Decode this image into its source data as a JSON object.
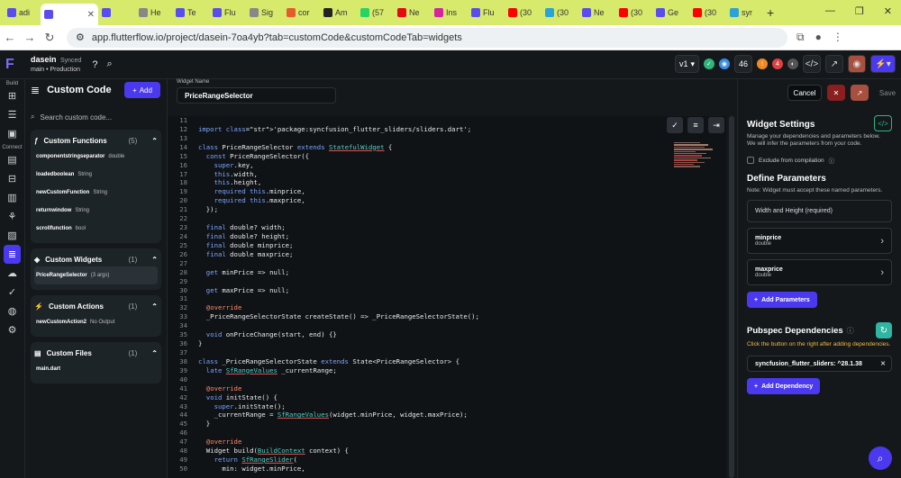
{
  "browser": {
    "tabs": [
      {
        "label": "adi",
        "color": "#5a4df0"
      },
      {
        "label": "",
        "color": "#5a4df0"
      },
      {
        "label": "",
        "color": "#5a4df0"
      },
      {
        "label": "He",
        "color": "#888888"
      },
      {
        "label": "Te",
        "color": "#5a4df0"
      },
      {
        "label": "Flu",
        "color": "#5a4df0"
      },
      {
        "label": "Sig",
        "color": "#888888"
      },
      {
        "label": "cor",
        "color": "#e55b2a"
      },
      {
        "label": "Am",
        "color": "#222222"
      },
      {
        "label": "(57",
        "color": "#25d366"
      },
      {
        "label": "Ne",
        "color": "#e50914"
      },
      {
        "label": "Ins",
        "color": "#d6249f"
      },
      {
        "label": "Flu",
        "color": "#5a4df0"
      },
      {
        "label": "(30",
        "color": "#ff0000"
      },
      {
        "label": "(30",
        "color": "#2aa3d8"
      },
      {
        "label": "Ne",
        "color": "#5a4df0"
      },
      {
        "label": "(30",
        "color": "#ff0000"
      },
      {
        "label": "Ge",
        "color": "#5a4df0"
      },
      {
        "label": "(30",
        "color": "#ff0000"
      },
      {
        "label": "syr",
        "color": "#2aa3d8"
      }
    ],
    "url": "app.flutterflow.io/project/dasein-7oa4yb?tab=customCode&customCodeTab=widgets"
  },
  "app": {
    "project_name": "dasein",
    "sync": "Synced",
    "branch": "main • Production",
    "version": "v1",
    "badge_count": "46",
    "notif_count": "4"
  },
  "sidebar": {
    "build_label": "Build",
    "connect_label": "Connect"
  },
  "panel": {
    "title": "Custom Code",
    "add_label": "Add",
    "search_placeholder": "Search custom code...",
    "groups": [
      {
        "title": "Custom Functions",
        "count": "(5)",
        "items": [
          {
            "name": "componentstringseparator",
            "type": "double"
          },
          {
            "name": "loadedboolean",
            "type": "String"
          },
          {
            "name": "newCustomFunction",
            "type": "String"
          },
          {
            "name": "returnwindow",
            "type": "String"
          },
          {
            "name": "scrollfunction",
            "type": "bool"
          }
        ]
      },
      {
        "title": "Custom Widgets",
        "count": "(1)",
        "items": [
          {
            "name": "PriceRangeSelector",
            "type": "(3 args)"
          }
        ]
      },
      {
        "title": "Custom Actions",
        "count": "(1)",
        "items": [
          {
            "name": "newCustomAction2",
            "type": "No Output"
          }
        ]
      },
      {
        "title": "Custom Files",
        "count": "(1)",
        "items": [
          {
            "name": "main.dart",
            "type": ""
          }
        ]
      }
    ]
  },
  "editor": {
    "widget_name_label": "Widget Name",
    "widget_name": "PriceRangeSelector",
    "cancel": "Cancel",
    "save": "Save",
    "lines": [
      {
        "n": "11",
        "t": ""
      },
      {
        "n": "12",
        "t": "import 'package:syncfusion_flutter_sliders/sliders.dart';"
      },
      {
        "n": "13",
        "t": ""
      },
      {
        "n": "14",
        "t": "class PriceRangeSelector extends StatefulWidget {"
      },
      {
        "n": "15",
        "t": "  const PriceRangeSelector({"
      },
      {
        "n": "16",
        "t": "    super.key,"
      },
      {
        "n": "17",
        "t": "    this.width,"
      },
      {
        "n": "18",
        "t": "    this.height,"
      },
      {
        "n": "19",
        "t": "    required this.minprice,"
      },
      {
        "n": "20",
        "t": "    required this.maxprice,"
      },
      {
        "n": "21",
        "t": "  });"
      },
      {
        "n": "22",
        "t": ""
      },
      {
        "n": "23",
        "t": "  final double? width;"
      },
      {
        "n": "24",
        "t": "  final double? height;"
      },
      {
        "n": "25",
        "t": "  final double minprice;"
      },
      {
        "n": "26",
        "t": "  final double maxprice;"
      },
      {
        "n": "27",
        "t": ""
      },
      {
        "n": "28",
        "t": "  get minPrice => null;"
      },
      {
        "n": "29",
        "t": ""
      },
      {
        "n": "30",
        "t": "  get maxPrice => null;"
      },
      {
        "n": "31",
        "t": ""
      },
      {
        "n": "32",
        "t": "  @override"
      },
      {
        "n": "33",
        "t": "  _PriceRangeSelectorState createState() => _PriceRangeSelectorState();"
      },
      {
        "n": "34",
        "t": ""
      },
      {
        "n": "35",
        "t": "  void onPriceChange(start, end) {}"
      },
      {
        "n": "36",
        "t": "}"
      },
      {
        "n": "37",
        "t": ""
      },
      {
        "n": "38",
        "t": "class _PriceRangeSelectorState extends State<PriceRangeSelector> {"
      },
      {
        "n": "39",
        "t": "  late SfRangeValues _currentRange;"
      },
      {
        "n": "40",
        "t": ""
      },
      {
        "n": "41",
        "t": "  @override"
      },
      {
        "n": "42",
        "t": "  void initState() {"
      },
      {
        "n": "43",
        "t": "    super.initState();"
      },
      {
        "n": "44",
        "t": "    _currentRange = SfRangeValues(widget.minPrice, widget.maxPrice);"
      },
      {
        "n": "45",
        "t": "  }"
      },
      {
        "n": "46",
        "t": ""
      },
      {
        "n": "47",
        "t": "  @override"
      },
      {
        "n": "48",
        "t": "  Widget build(BuildContext context) {"
      },
      {
        "n": "49",
        "t": "    return SfRangeSlider("
      },
      {
        "n": "50",
        "t": "      min: widget.minPrice,"
      }
    ]
  },
  "settings": {
    "title": "Widget Settings",
    "desc1": "Manage your dependencies and parameters below.",
    "desc2": "We will infer the parameters from your code.",
    "exclude": "Exclude from compilation",
    "define_title": "Define Parameters",
    "define_note": "Note: Widget must accept these named parameters.",
    "wh_label": "Width and Height (required)",
    "params": [
      {
        "name": "minprice",
        "type": "double"
      },
      {
        "name": "maxprice",
        "type": "double"
      }
    ],
    "add_params": "Add Parameters",
    "pubspec_title": "Pubspec Dependencies",
    "pubspec_note": "Click the button on the right after adding dependencies.",
    "dependency": "syncfusion_flutter_sliders: ^28.1.38",
    "add_dep": "Add Dependency"
  },
  "colors": {
    "accent": "#4b39ef",
    "bg": "#14181b",
    "tabbar": "#d7ea6b"
  }
}
